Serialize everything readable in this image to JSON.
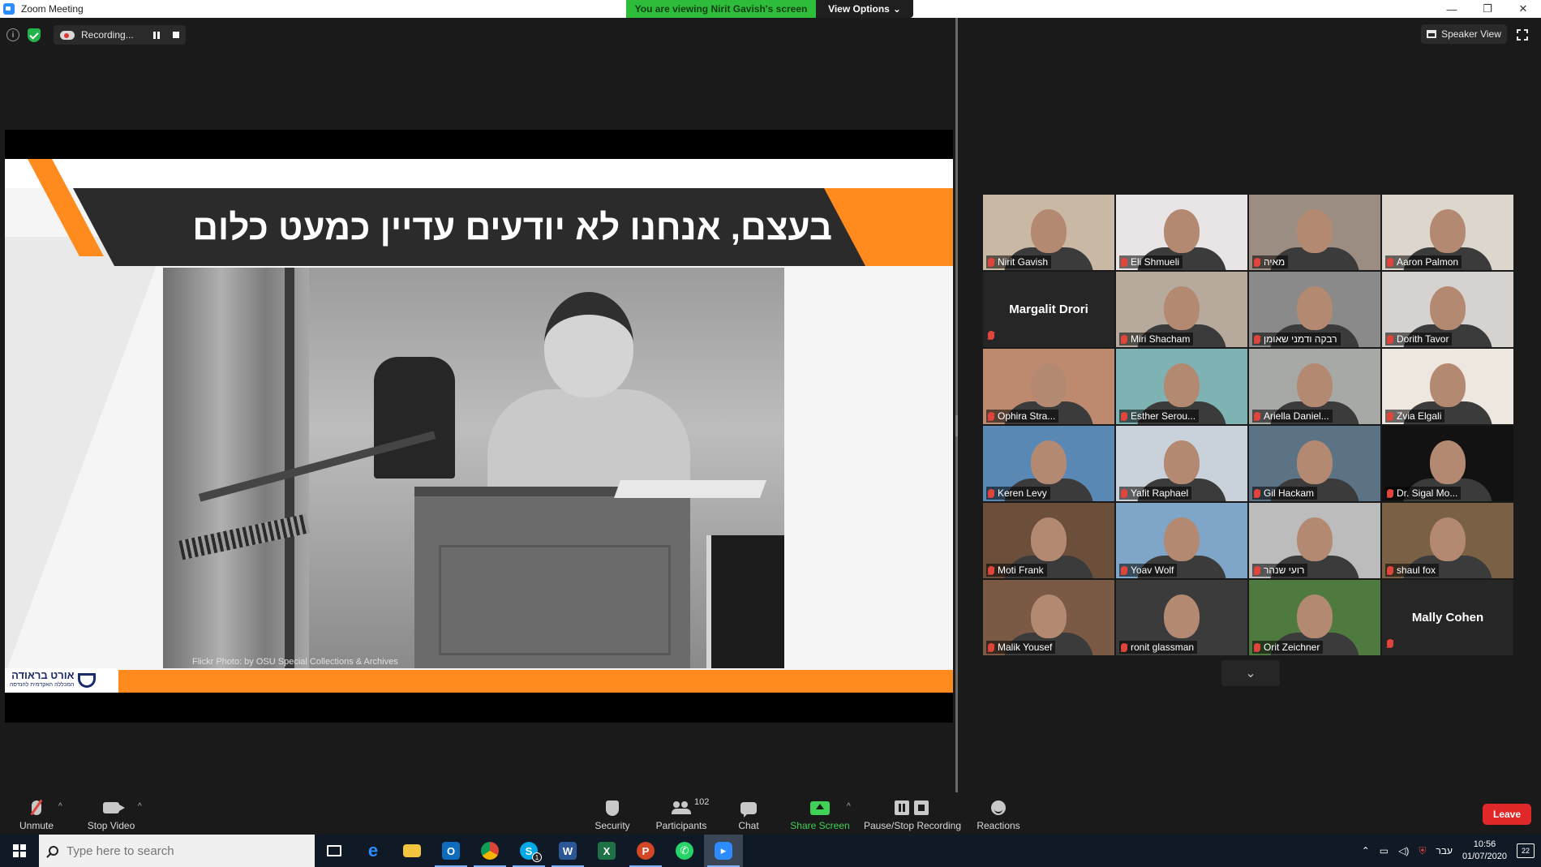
{
  "window": {
    "title": "Zoom Meeting",
    "viewing_banner": "You are viewing Nirit Gavish's screen",
    "view_options": "View Options"
  },
  "status": {
    "recording_label": "Recording..."
  },
  "speaker_view_label": "Speaker View",
  "slide": {
    "heading": "בעצם, אנחנו לא יודעים עדיין כמעט כלום",
    "photo_credit": "Flickr Photo: by OSU Special Collections & Archives",
    "logo_text": "אורט בראודה",
    "logo_subtext": "המכללה האקדמית להנדסה"
  },
  "participants": [
    {
      "name": "Nirit Gavish",
      "video": true,
      "active": true,
      "bg": "#c9b8a3"
    },
    {
      "name": "Eli Shmueli",
      "video": true,
      "active": false,
      "bg": "#e9e4e6"
    },
    {
      "name": "מאיה",
      "video": true,
      "active": false,
      "bg": "#9b8d82"
    },
    {
      "name": "Aaron Palmon",
      "video": true,
      "active": false,
      "bg": "#ddd6cc"
    },
    {
      "name": "Margalit Drori",
      "video": false,
      "active": false,
      "bg": "#262626"
    },
    {
      "name": "Miri Shacham",
      "video": true,
      "active": false,
      "bg": "#b7aa9c"
    },
    {
      "name": "רבקה ודמני שאומן",
      "video": true,
      "active": false,
      "bg": "#8a8a8a"
    },
    {
      "name": "Dorith Tavor",
      "video": true,
      "active": false,
      "bg": "#d6d2cf"
    },
    {
      "name": "Ophira Stra...",
      "video": true,
      "active": false,
      "bg": "#bd8a6f"
    },
    {
      "name": "Esther Serou...",
      "video": true,
      "active": false,
      "bg": "#7fb2b3"
    },
    {
      "name": "Ariella Daniel...",
      "video": true,
      "active": false,
      "bg": "#a7a9a6"
    },
    {
      "name": "Zvia Elgali",
      "video": true,
      "active": false,
      "bg": "#ede7e0"
    },
    {
      "name": "Keren Levy",
      "video": true,
      "active": false,
      "bg": "#5a88b5"
    },
    {
      "name": "Yafit Raphael",
      "video": true,
      "active": false,
      "bg": "#c9d2da"
    },
    {
      "name": "Gil Hackam",
      "video": true,
      "active": false,
      "bg": "#5c7386"
    },
    {
      "name": "Dr. Sigal Mo...",
      "video": true,
      "active": false,
      "bg": "#121212"
    },
    {
      "name": "Moti Frank",
      "video": true,
      "active": false,
      "bg": "#6c4f3a"
    },
    {
      "name": "Yoav Wolf",
      "video": true,
      "active": false,
      "bg": "#7fa5c9"
    },
    {
      "name": "רועי שנהר",
      "video": true,
      "active": false,
      "bg": "#bcbcbc"
    },
    {
      "name": "shaul fox",
      "video": true,
      "active": false,
      "bg": "#7a6146"
    },
    {
      "name": "Malik Yousef",
      "video": true,
      "active": false,
      "bg": "#7b5a45"
    },
    {
      "name": "ronit glassman",
      "video": true,
      "active": false,
      "bg": "#3b3b3b"
    },
    {
      "name": "Orit Zeichner",
      "video": true,
      "active": false,
      "bg": "#4f7a3f"
    },
    {
      "name": "Mally Cohen",
      "video": false,
      "active": false,
      "bg": "#262626"
    }
  ],
  "toolbar": {
    "unmute": "Unmute",
    "stop_video": "Stop Video",
    "security": "Security",
    "participants": "Participants",
    "participants_count": "102",
    "chat": "Chat",
    "share_screen": "Share Screen",
    "pause_stop_recording": "Pause/Stop Recording",
    "reactions": "Reactions",
    "leave": "Leave"
  },
  "taskbar": {
    "search_placeholder": "Type here to search",
    "skype_badge": "1",
    "language": "עבר",
    "time": "10:56",
    "date": "01/07/2020",
    "notifications": "22"
  },
  "colors": {
    "accent_green": "#2dbd3a",
    "leave_red": "#e02828",
    "slide_orange": "#ff8a1d",
    "active_speaker_outline": "#c7e64d"
  }
}
